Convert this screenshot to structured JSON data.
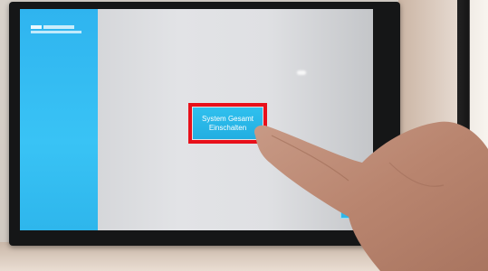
{
  "touch_screen": {
    "main_button": {
      "line1": "System Gesamt",
      "line2": "Einschalten"
    }
  },
  "colors": {
    "sidebar": "#2fb4ef",
    "button": "#22aee1",
    "highlight_box": "#e8101a",
    "bezel": "#151617"
  },
  "icons": {
    "corner_button": "small-cyan-button"
  }
}
